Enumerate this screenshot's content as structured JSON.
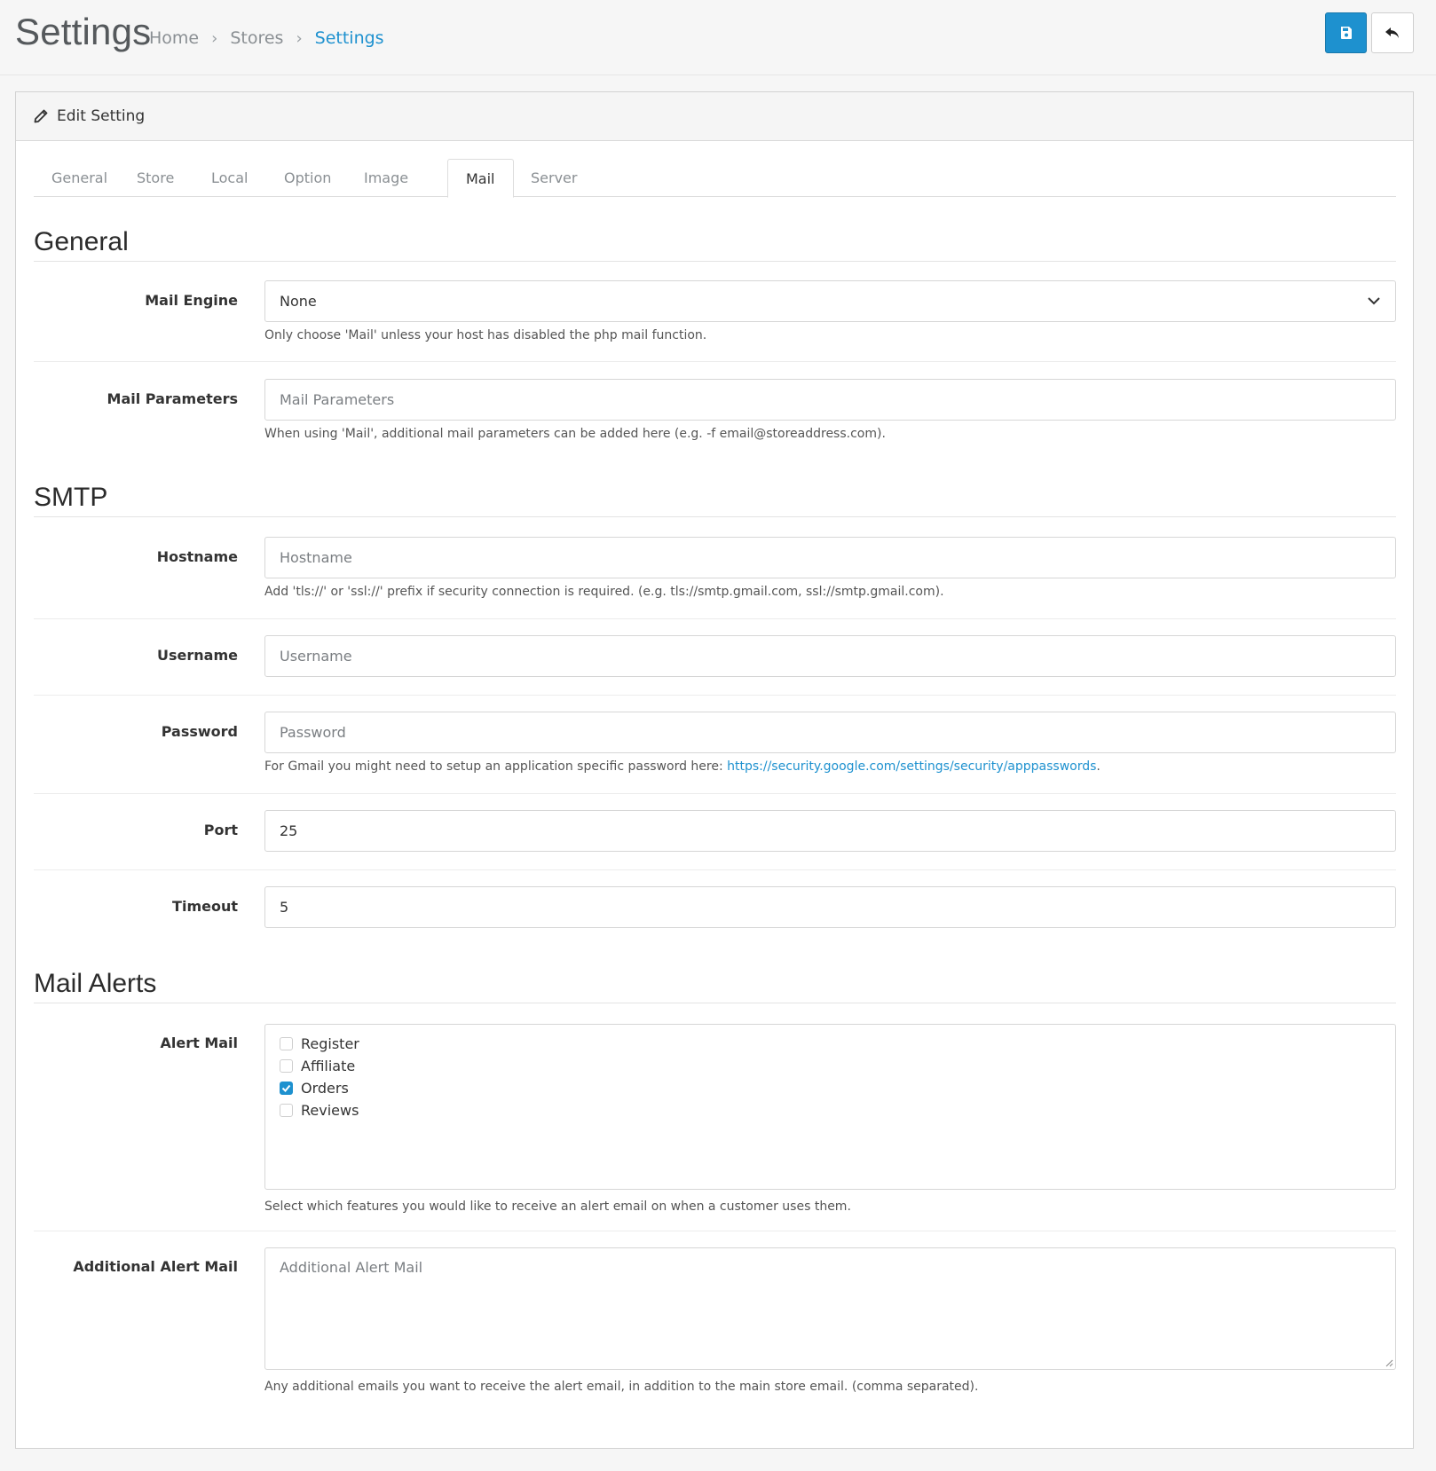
{
  "header": {
    "title": "Settings",
    "breadcrumb": [
      {
        "label": "Home"
      },
      {
        "label": "Stores"
      },
      {
        "label": "Settings"
      }
    ],
    "save_icon": "save-icon",
    "back_icon": "back-arrow-icon"
  },
  "card": {
    "title": "Edit Setting",
    "title_icon": "pencil-icon"
  },
  "tabs": [
    {
      "label": "General"
    },
    {
      "label": "Store"
    },
    {
      "label": "Local"
    },
    {
      "label": "Option"
    },
    {
      "label": "Image"
    },
    {
      "label": "Mail",
      "active": true
    },
    {
      "label": "Server"
    }
  ],
  "sections": {
    "general": "General",
    "smtp": "SMTP",
    "alerts": "Mail Alerts"
  },
  "fields": {
    "mail_engine": {
      "label": "Mail Engine",
      "value": "None",
      "help": "Only choose 'Mail' unless your host has disabled the php mail function."
    },
    "mail_parameters": {
      "label": "Mail Parameters",
      "placeholder": "Mail Parameters",
      "help": "When using 'Mail', additional mail parameters can be added here (e.g. -f email@storeaddress.com)."
    },
    "hostname": {
      "label": "Hostname",
      "placeholder": "Hostname",
      "help": "Add 'tls://' or 'ssl://' prefix if security connection is required. (e.g. tls://smtp.gmail.com, ssl://smtp.gmail.com)."
    },
    "username": {
      "label": "Username",
      "placeholder": "Username"
    },
    "password": {
      "label": "Password",
      "placeholder": "Password",
      "help_prefix": "For Gmail you might need to setup an application specific password here: ",
      "help_link": "https://security.google.com/settings/security/apppasswords",
      "help_suffix": "."
    },
    "port": {
      "label": "Port",
      "value": "25"
    },
    "timeout": {
      "label": "Timeout",
      "value": "5"
    },
    "alert_mail": {
      "label": "Alert Mail",
      "options": [
        {
          "label": "Register",
          "checked": false
        },
        {
          "label": "Affiliate",
          "checked": false
        },
        {
          "label": "Orders",
          "checked": true
        },
        {
          "label": "Reviews",
          "checked": false
        }
      ],
      "help": "Select which features you would like to receive an alert email on when a customer uses them."
    },
    "additional_alert_mail": {
      "label": "Additional Alert Mail",
      "placeholder": "Additional Alert Mail",
      "help": "Any additional emails you want to receive the alert email, in addition to the main store email. (comma separated)."
    }
  },
  "colors": {
    "accent": "#1e91cf",
    "background": "#f6f6f6"
  }
}
